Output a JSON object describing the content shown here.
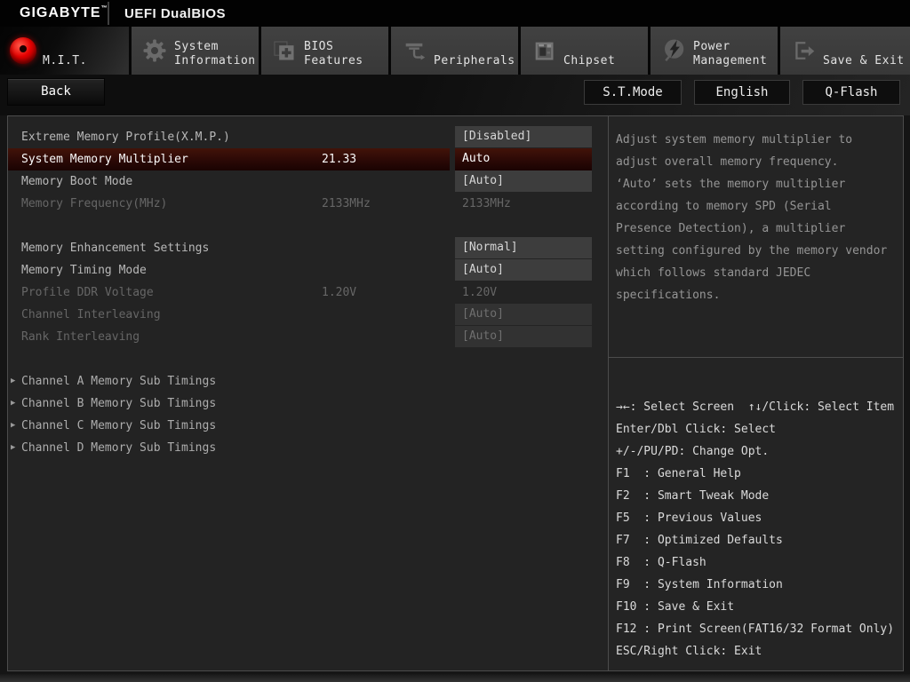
{
  "header": {
    "brand": "GIGABYTE",
    "brand_tm": "™",
    "product": "UEFI DualBIOS"
  },
  "tabs": [
    {
      "id": "mit",
      "lines": [
        "M.I.T."
      ],
      "icon": "mit-icon",
      "active": true
    },
    {
      "id": "system-information",
      "lines": [
        "System",
        "Information"
      ],
      "icon": "gear-icon",
      "active": false
    },
    {
      "id": "bios-features",
      "lines": [
        "BIOS",
        "Features"
      ],
      "icon": "folder-plus-icon",
      "active": false
    },
    {
      "id": "peripherals",
      "lines": [
        "Peripherals"
      ],
      "icon": "peripherals-icon",
      "active": false
    },
    {
      "id": "chipset",
      "lines": [
        "Chipset"
      ],
      "icon": "chip-icon",
      "active": false
    },
    {
      "id": "power-management",
      "lines": [
        "Power",
        "Management"
      ],
      "icon": "power-icon",
      "active": false
    },
    {
      "id": "save-exit",
      "lines": [
        "Save & Exit"
      ],
      "icon": "exit-icon",
      "active": false
    }
  ],
  "toolbar": {
    "back_label": "Back",
    "buttons": [
      "S.T.Mode",
      "English",
      "Q-Flash"
    ]
  },
  "settings": {
    "rows": [
      {
        "label": "Extreme Memory Profile(X.M.P.)",
        "mid": "",
        "value": "[Disabled]",
        "type": "boxed"
      },
      {
        "label": "System Memory Multiplier",
        "mid": "21.33",
        "value": "Auto",
        "type": "selected"
      },
      {
        "label": "Memory Boot Mode",
        "mid": "",
        "value": "[Auto]",
        "type": "boxed"
      },
      {
        "label": "Memory Frequency(MHz)",
        "mid": "2133MHz",
        "value": "2133MHz",
        "type": "plain-dim"
      },
      {
        "type": "spacer"
      },
      {
        "label": "Memory Enhancement Settings",
        "mid": "",
        "value": "[Normal]",
        "type": "boxed"
      },
      {
        "label": "Memory Timing Mode",
        "mid": "",
        "value": "[Auto]",
        "type": "boxed"
      },
      {
        "label": "Profile DDR Voltage",
        "mid": "1.20V",
        "value": "1.20V",
        "type": "plain-dim"
      },
      {
        "label": "Channel Interleaving",
        "mid": "",
        "value": "[Auto]",
        "type": "boxed-dim"
      },
      {
        "label": "Rank Interleaving",
        "mid": "",
        "value": "[Auto]",
        "type": "boxed-dim"
      },
      {
        "type": "spacer"
      },
      {
        "label": "Channel A Memory Sub Timings",
        "type": "submenu"
      },
      {
        "label": "Channel B Memory Sub Timings",
        "type": "submenu"
      },
      {
        "label": "Channel C Memory Sub Timings",
        "type": "submenu"
      },
      {
        "label": "Channel D Memory Sub Timings",
        "type": "submenu"
      }
    ]
  },
  "help": {
    "description_lines": [
      "Adjust system memory multiplier to",
      "adjust overall memory frequency.",
      "‘Auto’ sets the memory multiplier",
      "according to memory SPD (Serial",
      "Presence Detection), a multiplier",
      "setting configured by the memory vendor",
      "which follows standard JEDEC",
      "specifications."
    ]
  },
  "hotkeys": {
    "lines": [
      "→←: Select Screen  ↑↓/Click: Select Item",
      "Enter/Dbl Click: Select",
      "+/-/PU/PD: Change Opt.",
      "F1  : General Help",
      "F2  : Smart Tweak Mode",
      "F5  : Previous Values",
      "F7  : Optimized Defaults",
      "F8  : Q-Flash",
      "F9  : System Information",
      "F10 : Save & Exit",
      "F12 : Print Screen(FAT16/32 Format Only)",
      "ESC/Right Click: Exit"
    ]
  },
  "colors": {
    "accent_red": "#e60000",
    "selected_row_bg": "#2b0906"
  }
}
